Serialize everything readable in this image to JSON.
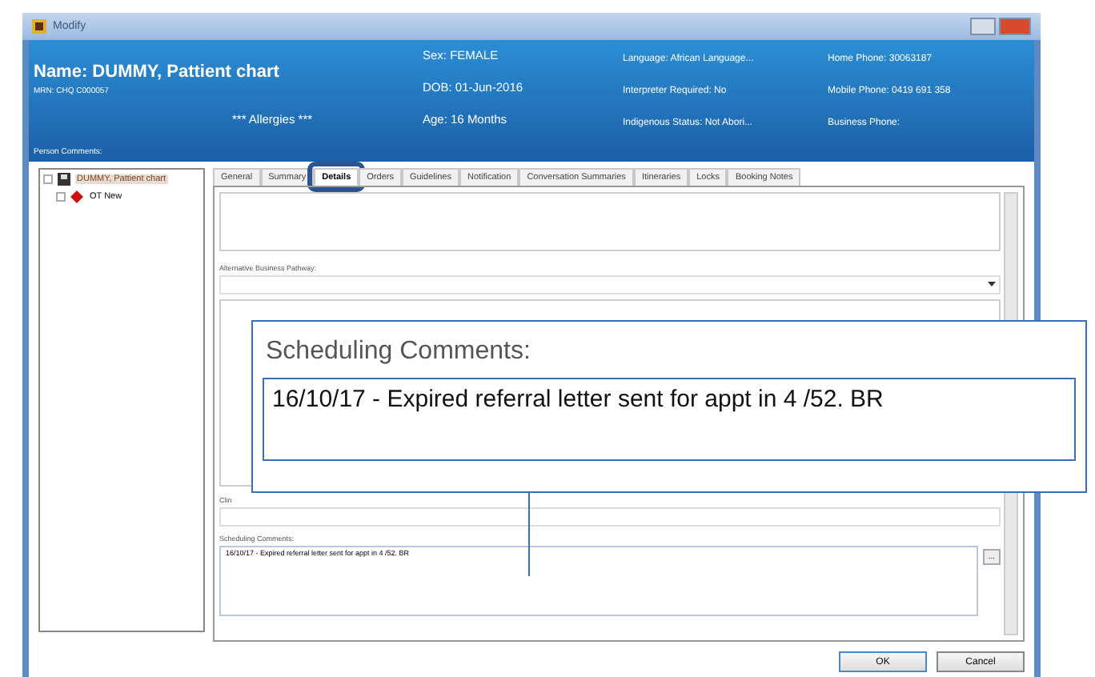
{
  "window": {
    "title": "Modify"
  },
  "header": {
    "name": "Name: DUMMY, Pattient chart",
    "mrn": "MRN: CHQ C000057",
    "allergies": "*** Allergies ***",
    "person_comments": "Person Comments:",
    "columns": [
      [
        "Sex: FEMALE",
        "DOB: 01-Jun-2016",
        "Age:  16 Months"
      ],
      [
        "Language: African Language...",
        "Interpreter Required: No",
        "Indigenous Status: Not Abori..."
      ],
      [
        "Home Phone: 30063187",
        "Mobile Phone: 0419 691 358",
        "Business Phone:"
      ]
    ]
  },
  "tree": [
    {
      "label": "DUMMY, Pattient chart",
      "selected": true,
      "children": [
        {
          "label": "OT New",
          "selected": false
        }
      ]
    }
  ],
  "tabs": [
    {
      "label": "General",
      "selected": false
    },
    {
      "label": "Summary",
      "selected": false
    },
    {
      "label": "Details",
      "selected": true
    },
    {
      "label": "Orders",
      "selected": false
    },
    {
      "label": "Guidelines",
      "selected": false
    },
    {
      "label": "Notification",
      "selected": false
    },
    {
      "label": "Conversation Summaries",
      "selected": false
    },
    {
      "label": "Itineraries",
      "selected": false
    },
    {
      "label": "Locks",
      "selected": false
    },
    {
      "label": "Booking Notes",
      "selected": false
    }
  ],
  "fields": {
    "alt_pathway_label": "Alternative Business Pathway:",
    "clinic_label": "Clin",
    "scheduling_label": "Scheduling Comments:",
    "scheduling_value": "16/10/17 - Expired referral letter sent for appt in 4 /52. BR",
    "ellipsis": "..."
  },
  "callout": {
    "label": "Scheduling Comments:",
    "value": "16/10/17 - Expired referral letter sent for appt in 4 /52. BR"
  },
  "buttons": [
    "OK",
    "Cancel"
  ]
}
